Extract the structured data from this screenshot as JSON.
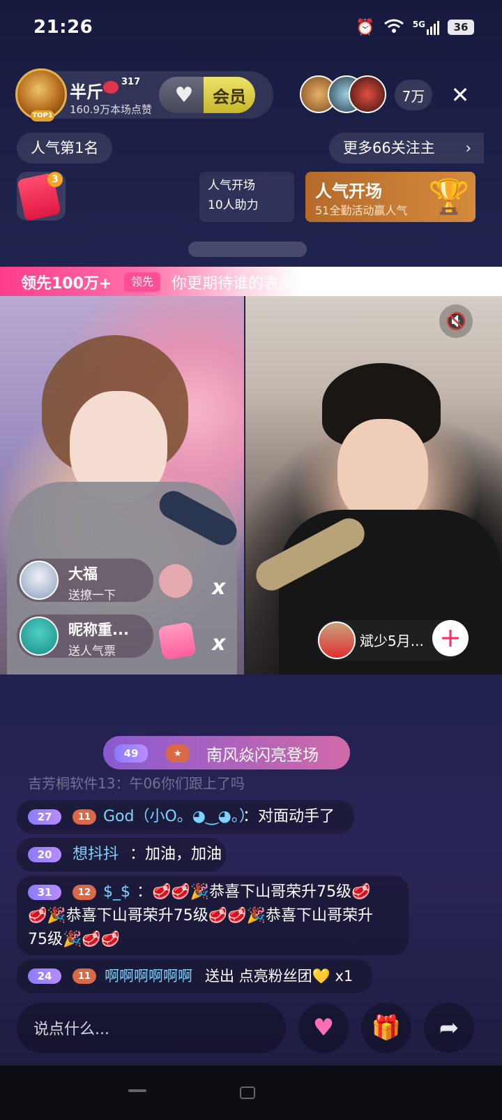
{
  "status_bar": {
    "time": "21:26",
    "network": "5G",
    "battery": "36"
  },
  "host": {
    "name": "半斤",
    "level": "317",
    "likes": "160.9万本场点赞",
    "top_badge": "TOP1"
  },
  "header": {
    "vip_label": "会员",
    "viewer_count": "7万",
    "close_icon": "close-icon"
  },
  "rank": {
    "label": "人气第1名"
  },
  "follow": {
    "label": "更多66关注主"
  },
  "red_packet": {
    "count": "3"
  },
  "assist": {
    "line1": "人气开场",
    "line2": "10人助力"
  },
  "banner": {
    "title": "人气开场",
    "subtitle": "51全勤活动赢人气"
  },
  "pk": {
    "lead_text": "领先100万+",
    "lead_tag": "领先",
    "question": "你更期待谁的表演?"
  },
  "gifts": [
    {
      "name": "大福",
      "action": "送撩一下",
      "x": "x"
    },
    {
      "name": "昵称重...",
      "action": "送人气票",
      "x": "x"
    }
  ],
  "guest": {
    "name": "斌少5月..."
  },
  "entrance": {
    "level": "49",
    "text": "南风焱闪亮登场"
  },
  "chat": {
    "faded": "吉芳桐软件13：午06你们跟上了吗",
    "messages": [
      {
        "level": "27",
        "fan": "11",
        "name": "God（小O。◕‿◕。）",
        "text": "：对面动手了"
      },
      {
        "level": "20",
        "name": "想抖抖",
        "text": "：加油，加油"
      },
      {
        "level": "31",
        "fan": "12",
        "name": "$_$",
        "line1": "：🥩🥩🎉恭喜下山哥荣升75级🥩",
        "line2": "🥩🎉恭喜下山哥荣升75级🥩🥩🎉恭喜下山哥荣升",
        "line3": "75级🎉🥩🥩"
      },
      {
        "level": "24",
        "fan": "11",
        "name": "啊啊啊啊啊啊",
        "text": "送出 点亮粉丝团💛 x1"
      }
    ]
  },
  "input": {
    "placeholder": "说点什么..."
  },
  "colors": {
    "accent_pink": "#ff3d8b",
    "vip_yellow": "#e6dc5a",
    "banner_orange": "#c97b33",
    "name_blue": "#7fd4ff"
  }
}
